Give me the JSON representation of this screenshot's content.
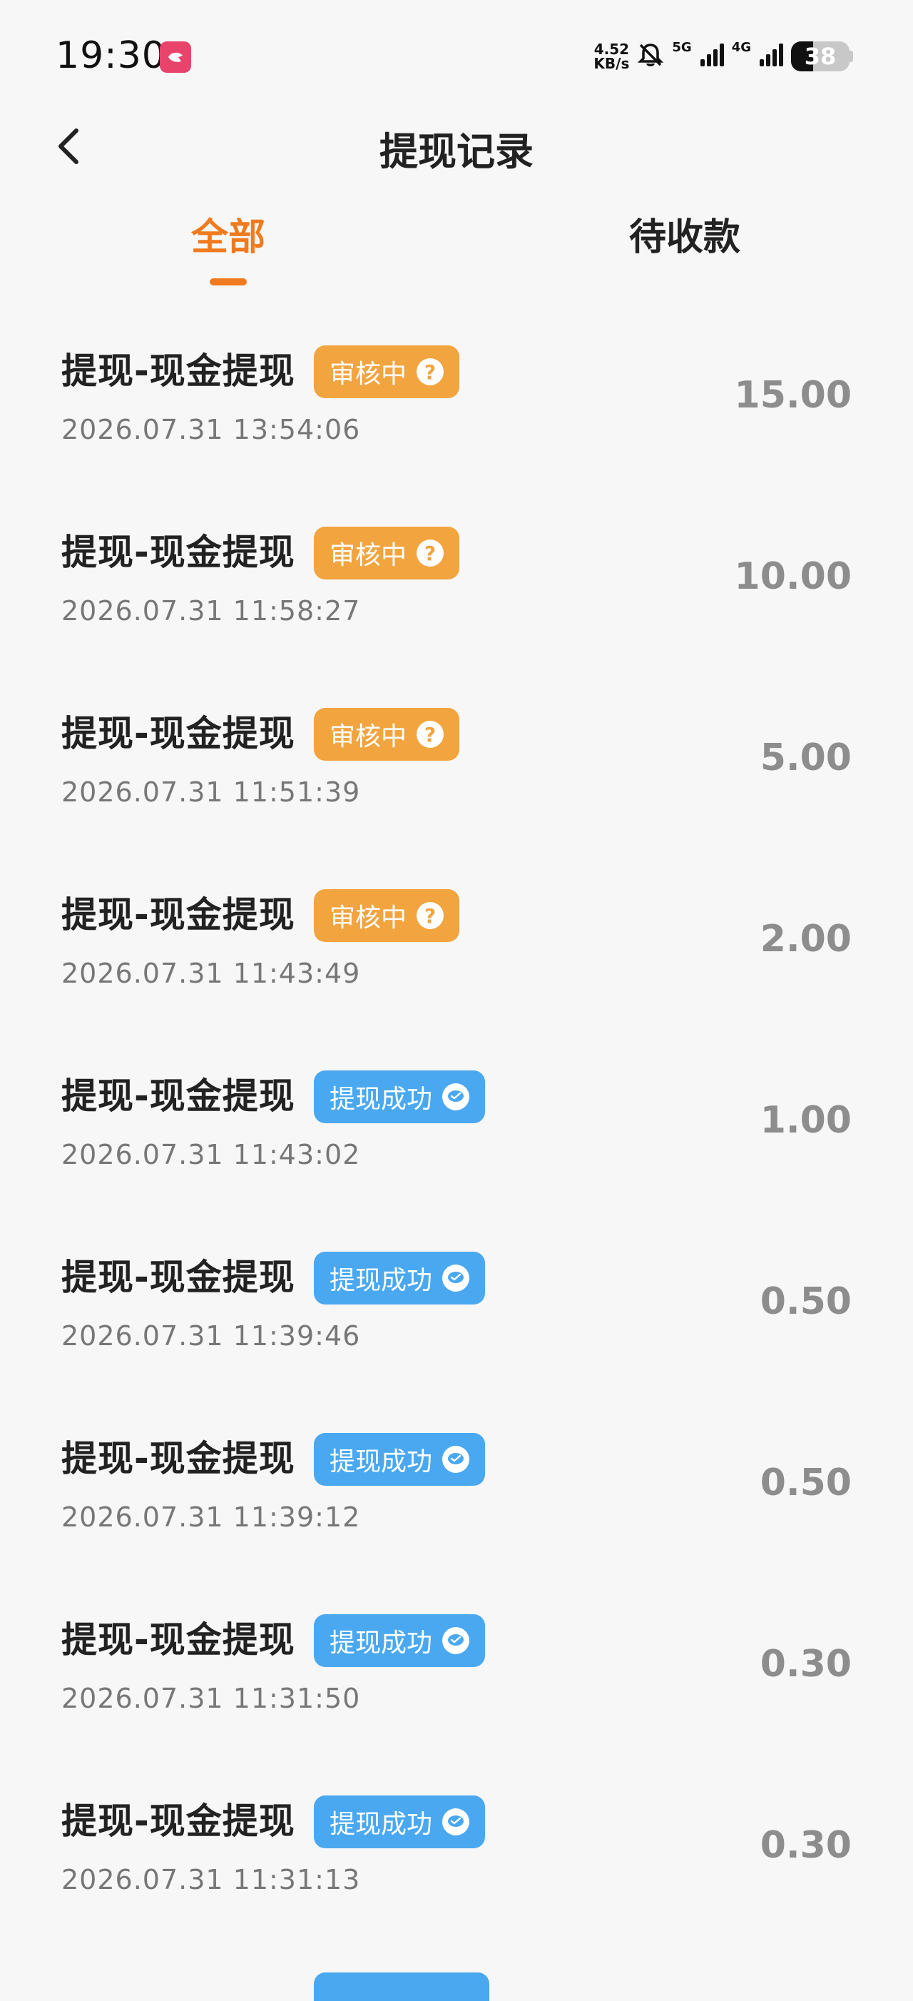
{
  "status_bar": {
    "time": "19:30",
    "net_speed_value": "4.52",
    "net_speed_unit": "KB/s",
    "net_5g": "5G",
    "net_4g": "4G",
    "battery": "38",
    "battery_level": 0.38
  },
  "header": {
    "title": "提现记录"
  },
  "tabs": [
    {
      "label": "全部",
      "active": true
    },
    {
      "label": "待收款",
      "active": false
    }
  ],
  "colors": {
    "accent": "#f07a1e",
    "review": "#f2a43e",
    "success": "#4aa8f0"
  },
  "records": [
    {
      "title": "提现-现金提现",
      "status": "审核中",
      "status_type": "review",
      "status_icon": "question-icon",
      "time": "2026.07.31 13:54:06",
      "amount": "15.00"
    },
    {
      "title": "提现-现金提现",
      "status": "审核中",
      "status_type": "review",
      "status_icon": "question-icon",
      "time": "2026.07.31 11:58:27",
      "amount": "10.00"
    },
    {
      "title": "提现-现金提现",
      "status": "审核中",
      "status_type": "review",
      "status_icon": "question-icon",
      "time": "2026.07.31 11:51:39",
      "amount": "5.00"
    },
    {
      "title": "提现-现金提现",
      "status": "审核中",
      "status_type": "review",
      "status_icon": "question-icon",
      "time": "2026.07.31 11:43:49",
      "amount": "2.00"
    },
    {
      "title": "提现-现金提现",
      "status": "提现成功",
      "status_type": "success",
      "status_icon": "wechat-icon",
      "time": "2026.07.31 11:43:02",
      "amount": "1.00"
    },
    {
      "title": "提现-现金提现",
      "status": "提现成功",
      "status_type": "success",
      "status_icon": "wechat-icon",
      "time": "2026.07.31 11:39:46",
      "amount": "0.50"
    },
    {
      "title": "提现-现金提现",
      "status": "提现成功",
      "status_type": "success",
      "status_icon": "wechat-icon",
      "time": "2026.07.31 11:39:12",
      "amount": "0.50"
    },
    {
      "title": "提现-现金提现",
      "status": "提现成功",
      "status_type": "success",
      "status_icon": "wechat-icon",
      "time": "2026.07.31 11:31:50",
      "amount": "0.30"
    },
    {
      "title": "提现-现金提现",
      "status": "提现成功",
      "status_type": "success",
      "status_icon": "wechat-icon",
      "time": "2026.07.31 11:31:13",
      "amount": "0.30"
    }
  ]
}
